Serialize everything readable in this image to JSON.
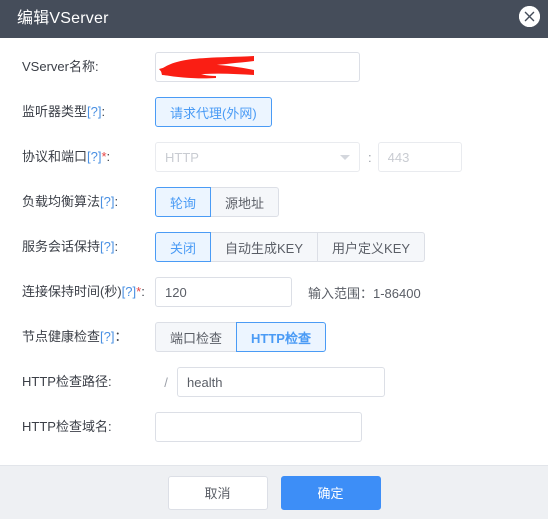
{
  "header": {
    "title": "编辑VServer",
    "close_icon": "close-circle-icon"
  },
  "form": {
    "vserver_name": {
      "label": "VServer名称:",
      "value": "",
      "placeholder": "",
      "redacted": true
    },
    "listener_type": {
      "label_text": "监听器类型",
      "label_help": "[?]",
      "label_suffix": ":",
      "options": [
        "请求代理(外网)"
      ],
      "selected": "请求代理(外网)"
    },
    "protocol_port": {
      "label_text": "协议和端口",
      "label_help": "[?]",
      "label_required": "*",
      "label_suffix": ":",
      "protocol_value": "HTTP",
      "separator": ":",
      "port_value": "443",
      "disabled": true
    },
    "balance_algorithm": {
      "label_text": "负载均衡算法",
      "label_help": "[?]",
      "label_suffix": ":",
      "options": [
        "轮询",
        "源地址"
      ],
      "selected": "轮询"
    },
    "session_persistence": {
      "label_text": "服务会话保持",
      "label_help": "[?]",
      "label_suffix": ":",
      "options": [
        "关闭",
        "自动生成KEY",
        "用户定义KEY"
      ],
      "selected": "关闭"
    },
    "keepalive_time": {
      "label_text": "连接保持时间(秒)",
      "label_help": "[?]",
      "label_required": "*",
      "label_suffix": ":",
      "value": "120",
      "hint": "输入范围：1-86400"
    },
    "health_check": {
      "label_text": "节点健康检查",
      "label_help": "[?]",
      "label_suffix": "：",
      "options": [
        "端口检查",
        "HTTP检查"
      ],
      "selected": "HTTP检查"
    },
    "http_check_path": {
      "label": "HTTP检查路径:",
      "prefix": "/",
      "value": "health"
    },
    "http_check_domain": {
      "label": "HTTP检查域名:",
      "value": "",
      "placeholder": ""
    }
  },
  "footer": {
    "cancel_label": "取消",
    "confirm_label": "确定"
  },
  "colors": {
    "header_bg": "#454d5a",
    "accent_blue": "#4a9bf5",
    "primary_button": "#3d8ef7",
    "footer_bg": "#eef0f3",
    "required_red": "#e64545",
    "redaction_red": "#fa1e14"
  }
}
